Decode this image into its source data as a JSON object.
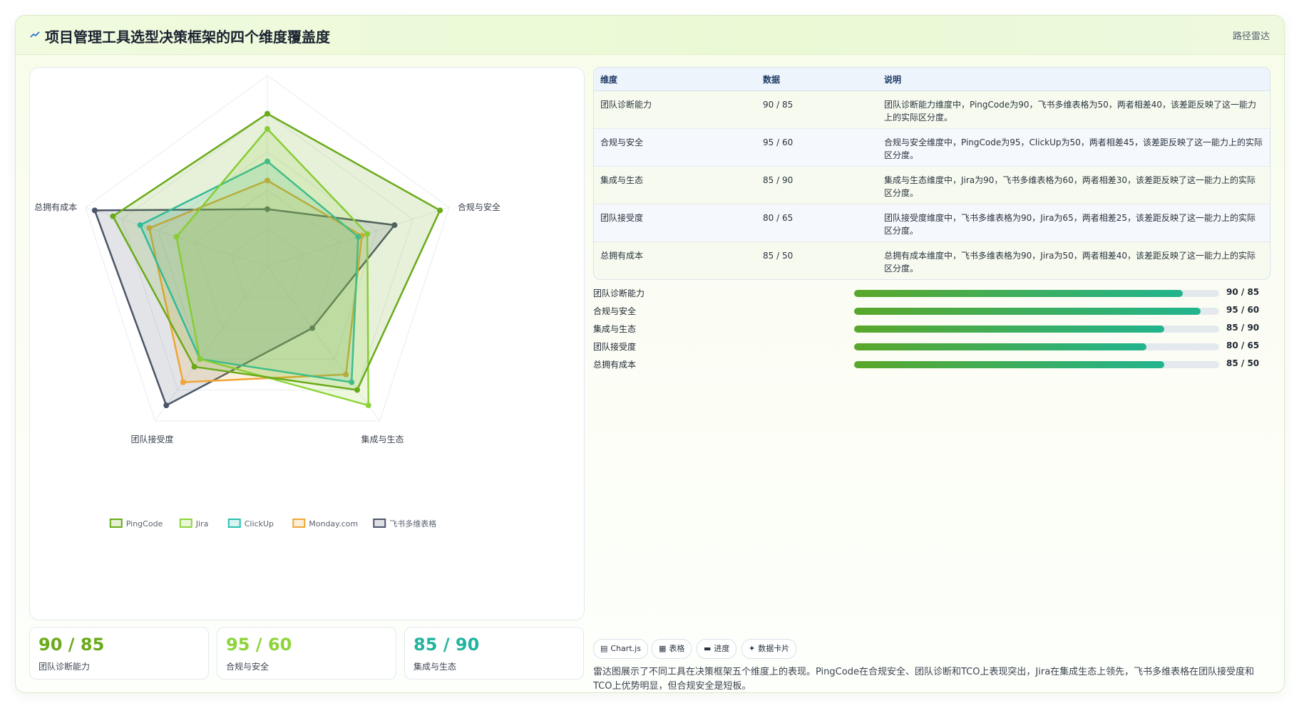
{
  "header": {
    "title": "项目管理工具选型决策框架的四个维度覆盖度",
    "title_icon": "line-chart-icon",
    "badge": "路径雷达"
  },
  "chart_data": {
    "type": "radar",
    "categories": [
      "团队诊断能力",
      "合规与安全",
      "集成与生态",
      "团队接受度",
      "总拥有成本"
    ],
    "rlim": [
      0,
      100
    ],
    "grid": true,
    "legend_position": "bottom",
    "series": [
      {
        "name": "PingCode",
        "values": [
          80,
          95,
          80,
          65,
          85
        ],
        "color": "#6aaa1a"
      },
      {
        "name": "Jira",
        "values": [
          72,
          55,
          90,
          60,
          50
        ],
        "color": "#8dd43a"
      },
      {
        "name": "ClickUp",
        "values": [
          55,
          50,
          75,
          60,
          70
        ],
        "color": "#28bfb0"
      },
      {
        "name": "Monday.com",
        "values": [
          45,
          52,
          70,
          75,
          65
        ],
        "color": "#f0a534"
      },
      {
        "name": "飞书多维表格",
        "values": [
          30,
          70,
          40,
          90,
          95
        ],
        "color": "#4b5568"
      }
    ]
  },
  "table": {
    "headers": [
      "维度",
      "数据",
      "说明"
    ],
    "rows": [
      [
        "团队诊断能力",
        "90 / 85",
        "团队诊断能力维度中，PingCode为90，飞书多维表格为50，两者相差40，该差距反映了这一能力上的实际区分度。"
      ],
      [
        "合规与安全",
        "95 / 60",
        "合规与安全维度中，PingCode为95，ClickUp为50，两者相差45，该差距反映了这一能力上的实际区分度。"
      ],
      [
        "集成与生态",
        "85 / 90",
        "集成与生态维度中，Jira为90，飞书多维表格为60，两者相差30，该差距反映了这一能力上的实际区分度。"
      ],
      [
        "团队接受度",
        "80 / 65",
        "团队接受度维度中，飞书多维表格为90，Jira为65，两者相差25，该差距反映了这一能力上的实际区分度。"
      ],
      [
        "总拥有成本",
        "85 / 50",
        "总拥有成本维度中，飞书多维表格为90，Jira为50，两者相差40，该差距反映了这一能力上的实际区分度。"
      ]
    ]
  },
  "progress": [
    {
      "label": "团队诊断能力",
      "value": "90 / 85",
      "fraction": 0.9
    },
    {
      "label": "合规与安全",
      "value": "95 / 60",
      "fraction": 0.95
    },
    {
      "label": "集成与生态",
      "value": "85 / 90",
      "fraction": 0.85
    },
    {
      "label": "团队接受度",
      "value": "80 / 65",
      "fraction": 0.8
    },
    {
      "label": "总拥有成本",
      "value": "85 / 50",
      "fraction": 0.85
    }
  ],
  "stats": [
    {
      "value": "90 / 85",
      "label": "团队诊断能力",
      "color": "#6aaa1a"
    },
    {
      "value": "95 / 60",
      "label": "合规与安全",
      "color": "#8dd43a"
    },
    {
      "value": "85 / 90",
      "label": "集成与生态",
      "color": "#22b49e"
    }
  ],
  "chips": [
    {
      "icon": "chart-icon",
      "glyph": "▤",
      "label": "Chart.js"
    },
    {
      "icon": "table-icon",
      "glyph": "▦",
      "label": "表格"
    },
    {
      "icon": "progress-icon",
      "glyph": "▬",
      "label": "进度"
    },
    {
      "icon": "card-icon",
      "glyph": "✦",
      "label": "数据卡片"
    }
  ],
  "footer": {
    "text": "雷达图展示了不同工具在决策框架五个维度上的表现。PingCode在合规安全、团队诊断和TCO上表现突出，Jira在集成生态上领先，飞书多维表格在团队接受度和TCO上优势明显，但合规安全是短板。"
  }
}
